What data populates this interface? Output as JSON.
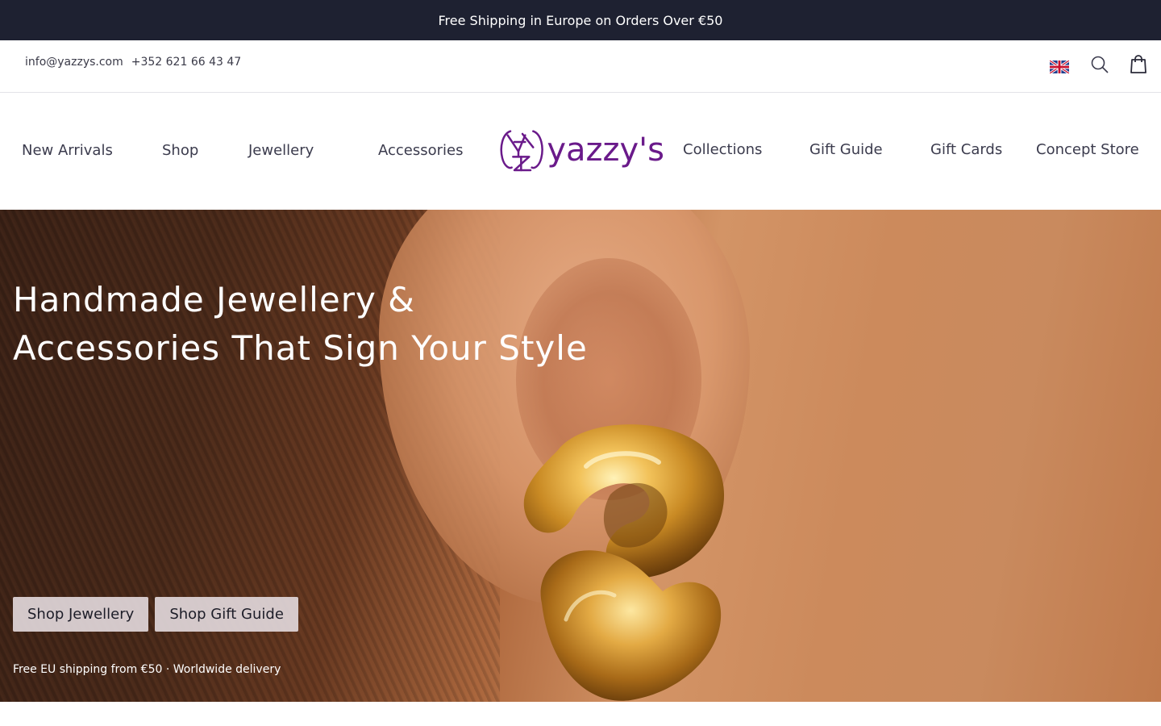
{
  "announcement": {
    "text": "Free Shipping in Europe on Orders Over €50"
  },
  "utility": {
    "email": "info@yazzys.com",
    "phone": "+352 621 66 43 47",
    "language_icon": "uk-flag-icon",
    "search_icon": "search-icon",
    "cart_icon": "shopping-bag-icon"
  },
  "nav": {
    "left": [
      {
        "label": "New Arrivals"
      },
      {
        "label": "Shop"
      },
      {
        "label": "Jewellery"
      },
      {
        "label": "Accessories"
      }
    ],
    "right": [
      {
        "label": "Collections"
      },
      {
        "label": "Gift Guide"
      },
      {
        "label": "Gift Cards"
      },
      {
        "label": "Concept Store"
      }
    ],
    "logo_text": "yazzy's"
  },
  "hero": {
    "title_line1": "Handmade Jewellery &",
    "title_line2": "Accessories That Sign Your Style",
    "buttons": [
      {
        "label": "Shop Jewellery"
      },
      {
        "label": "Shop Gift Guide"
      }
    ],
    "note": "Free EU shipping from €50 · Worldwide delivery"
  },
  "colors": {
    "announcement_bg": "#1e2131",
    "brand_purple": "#6a1a8a",
    "nav_text": "#3b3b4d"
  }
}
